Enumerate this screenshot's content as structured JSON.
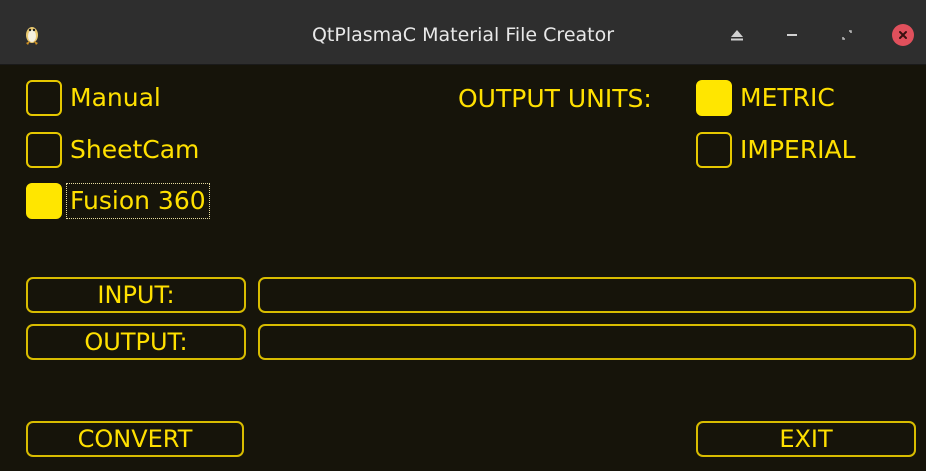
{
  "window": {
    "title": "QtPlasmaC Material File Creator",
    "controls": [
      "eject-icon",
      "minimize-icon",
      "restore-icon",
      "close-icon"
    ]
  },
  "source": {
    "options": [
      {
        "label": "Manual",
        "checked": false
      },
      {
        "label": "SheetCam",
        "checked": false
      },
      {
        "label": "Fusion 360",
        "checked": true
      }
    ]
  },
  "units": {
    "label": "OUTPUT UNITS:",
    "options": [
      {
        "label": "METRIC",
        "checked": true
      },
      {
        "label": "IMPERIAL",
        "checked": false
      }
    ]
  },
  "io": {
    "input_button": "INPUT:",
    "input_value": "",
    "output_button": "OUTPUT:",
    "output_value": ""
  },
  "actions": {
    "convert": "CONVERT",
    "exit": "EXIT"
  },
  "colors": {
    "background": "#16140a",
    "accent": "#ffe600",
    "titlebar": "#2e2e2e",
    "close": "#e0505c"
  }
}
